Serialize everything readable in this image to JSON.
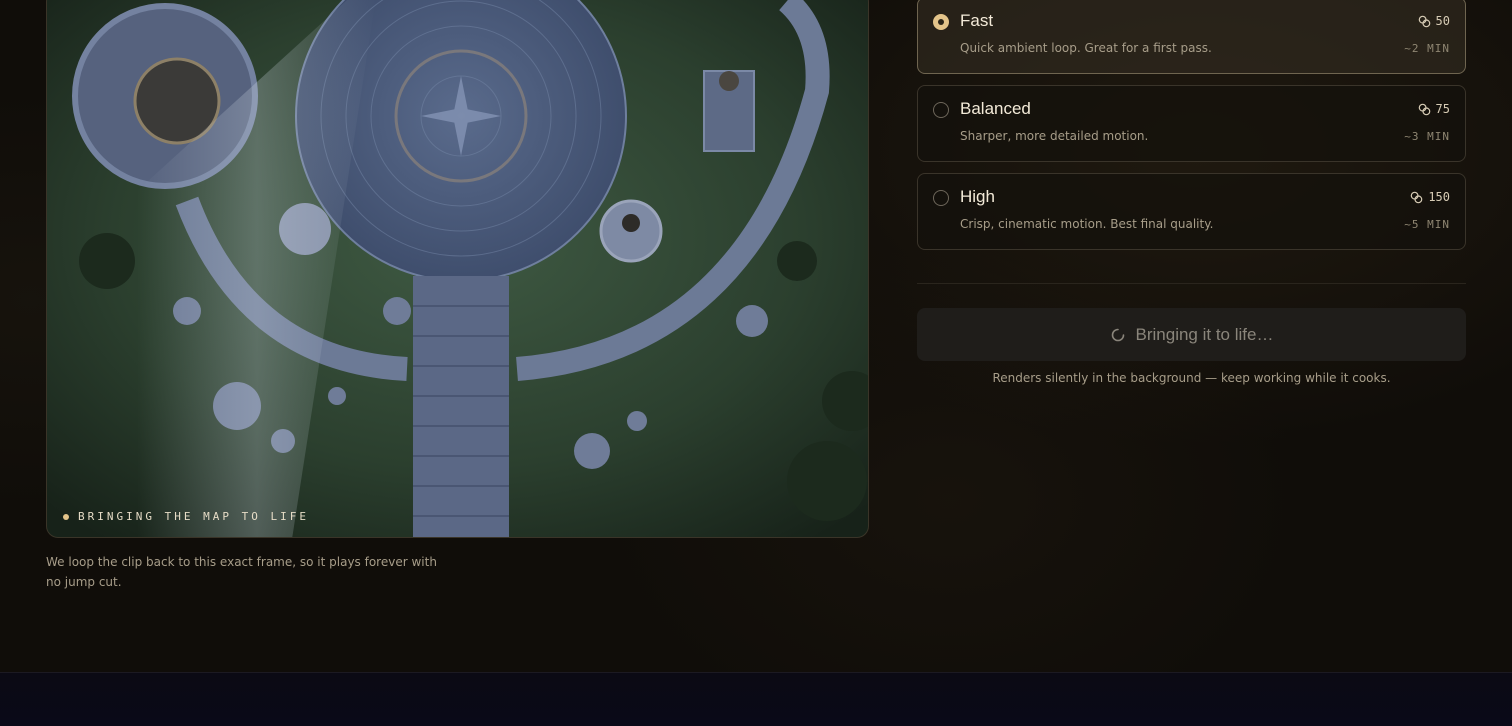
{
  "preview": {
    "badge": "BRINGING THE MAP TO LIFE",
    "caption": "We loop the clip back to this exact frame, so it plays forever with no jump cut."
  },
  "options": [
    {
      "title": "Fast",
      "description": "Quick ambient loop. Great for a first pass.",
      "cost": "50",
      "time": "~2 MIN",
      "selected": true
    },
    {
      "title": "Balanced",
      "description": "Sharper, more detailed motion.",
      "cost": "75",
      "time": "~3 MIN",
      "selected": false
    },
    {
      "title": "High",
      "description": "Crisp, cinematic motion. Best final quality.",
      "cost": "150",
      "time": "~5 MIN",
      "selected": false
    }
  ],
  "render": {
    "label": "Bringing it to life…",
    "note": "Renders silently in the background — keep working while it cooks."
  },
  "colors": {
    "accent": "#e3c48a",
    "background": "#100d09",
    "bottom_section": "#0a0918"
  },
  "icons": {
    "cost": "coins-icon",
    "loading": "spinner-icon"
  }
}
